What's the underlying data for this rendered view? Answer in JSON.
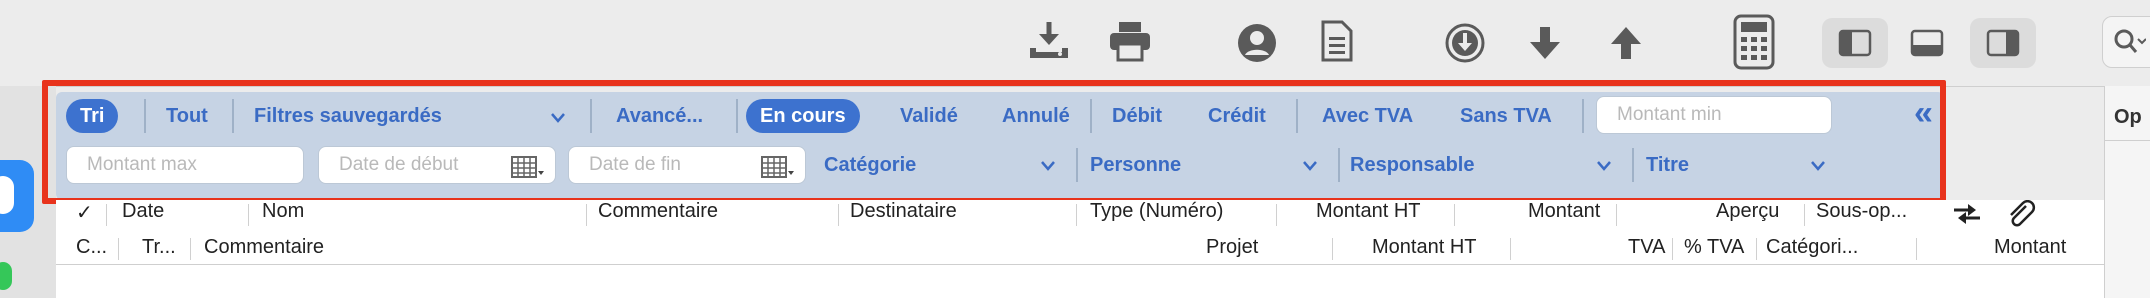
{
  "toolbar": {
    "icons": [
      "download-icon",
      "print-icon",
      "user-icon",
      "document-icon",
      "arrow-down-circle-icon",
      "arrow-down-icon",
      "arrow-up-icon",
      "calculator-icon",
      "sidebar-left-icon",
      "panel-bottom-icon",
      "sidebar-right-icon",
      "search-icon"
    ]
  },
  "filters": {
    "sort": "Tri",
    "all": "Tout",
    "saved_filters": "Filtres sauvegardés",
    "advanced": "Avancé...",
    "status": [
      "En cours",
      "Validé",
      "Annulé"
    ],
    "direction": [
      "Débit",
      "Crédit"
    ],
    "vat": [
      "Avec TVA",
      "Sans TVA"
    ],
    "amount_min_placeholder": "Montant min",
    "amount_max_placeholder": "Montant max",
    "start_date_placeholder": "Date de début",
    "end_date_placeholder": "Date de fin",
    "category": "Catégorie",
    "person": "Personne",
    "responsible": "Responsable",
    "title": "Titre",
    "collapse_symbol": "«"
  },
  "table": {
    "header_row1": {
      "check": "✓",
      "date": "Date",
      "name": "Nom",
      "comment": "Commentaire",
      "recipient": "Destinataire",
      "type": "Type (Numéro)",
      "amount_ht": "Montant HT",
      "amount": "Montant",
      "preview": "Aperçu",
      "sub_op": "Sous-op..."
    },
    "header_row2": {
      "c": "C...",
      "tr": "Tr...",
      "comment": "Commentaire",
      "project": "Projet",
      "amount_ht": "Montant HT",
      "vat": "TVA",
      "vat_pct": "% TVA",
      "category": "Catégori...",
      "amount": "Montant"
    },
    "right_header": "Op"
  },
  "colors": {
    "filter_bg": "#c6d3e4",
    "accent": "#3d72cf",
    "highlight_frame": "#e8331c"
  }
}
